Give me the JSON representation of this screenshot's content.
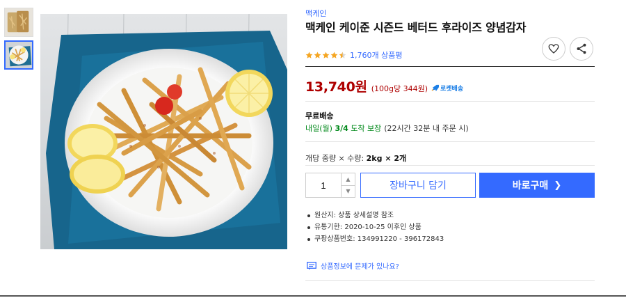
{
  "thumbnails": [
    {
      "icon": "fries-package-thumbnail",
      "active": false
    },
    {
      "icon": "fries-plate-thumbnail",
      "active": true
    }
  ],
  "main_image": {
    "icon": "fries-plate-photo"
  },
  "product": {
    "brand": "맥케인",
    "title": "맥케인 케이준 시즌드 베터드 후라이즈 양념감자",
    "rating": 4.5,
    "review_count": "1,760개 상품평"
  },
  "price": {
    "amount": "13,740원",
    "unit_price": "(100g당 344원)",
    "rocket_label": "로켓배송",
    "rocket_color": "#1c7fe6"
  },
  "shipping": {
    "title": "무료배송",
    "eta_prefix": "내일(월) ",
    "eta_date": "3/4",
    "eta_suffix": " 도착 보장",
    "eta_note": "(22시간 32분 내 주문 시)"
  },
  "spec": {
    "label": "개당 중량 × 수량: ",
    "value": "2kg × 2개"
  },
  "purchase": {
    "quantity": "1",
    "cart_label": "장바구니 담기",
    "buy_label": "바로구매",
    "buy_chevron": "❯"
  },
  "details": [
    "원산지: 상품 상세설명 참조",
    "유통기한: 2020-10-25 이후인 상품",
    "쿠팡상품번호: 134991220 - 396172843"
  ],
  "report_link": "상품정보에 문제가 있나요?",
  "colors": {
    "accent": "#346aff",
    "price": "#ae0000",
    "eta": "#00891a",
    "star": "#f5a623"
  }
}
